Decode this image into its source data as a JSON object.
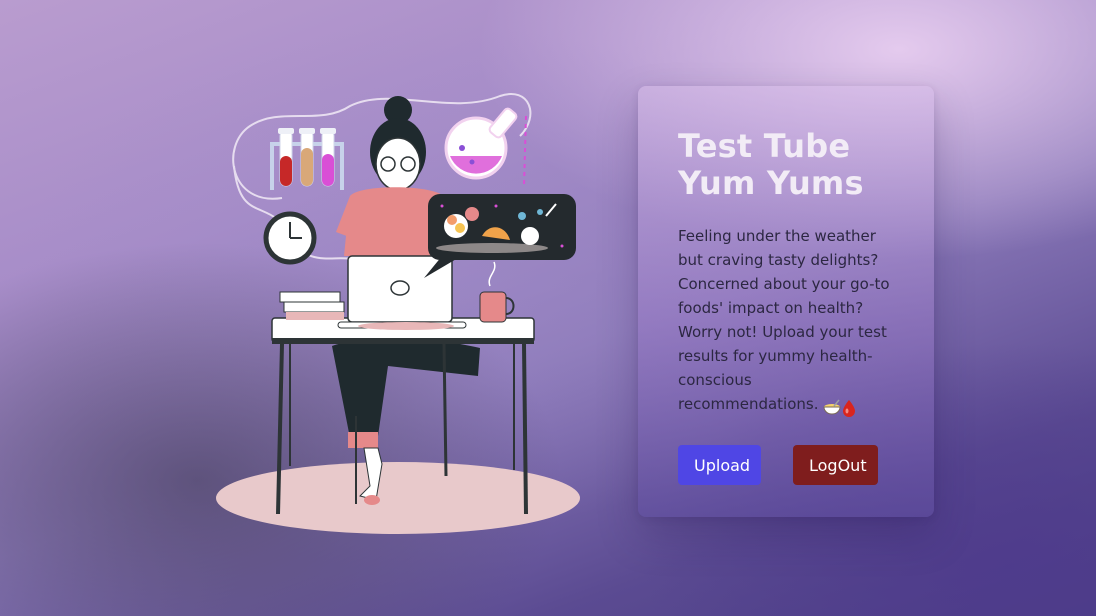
{
  "hero": {
    "title": "Test Tube Yum Yums",
    "description": "Feeling under the weather but craving tasty delights? Concerned about your go-to foods' impact on health? Worry not! Upload your test results for yummy health-conscious recommendations.",
    "emojis": [
      "bowl-with-spoon-icon",
      "blood-drop-icon"
    ]
  },
  "actions": {
    "upload_label": "Upload",
    "logout_label": "LogOut"
  },
  "colors": {
    "upload": "#4f46e5",
    "logout": "#7f1d1d",
    "title": "#f2ecf6",
    "text": "#2c2742"
  },
  "illustration": {
    "icons": [
      "test-tube-rack-icon",
      "clock-icon",
      "flask-icon",
      "food-speech-bubble-icon",
      "laptop-icon",
      "coffee-mug-icon",
      "book-stack-icon"
    ]
  }
}
